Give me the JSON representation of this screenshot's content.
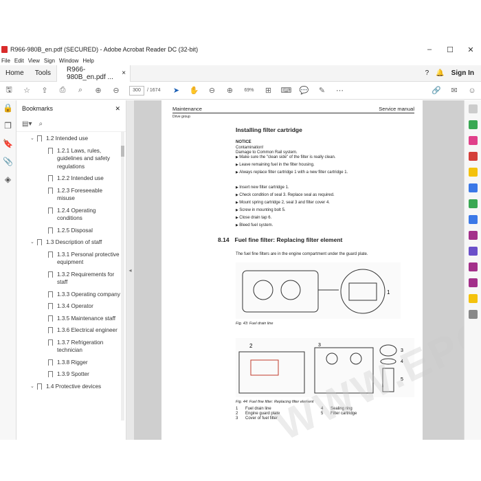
{
  "window": {
    "title": "R966-980B_en.pdf (SECURED) - Adobe Acrobat Reader DC (32-bit)",
    "minimize": "–",
    "maximize": "☐",
    "close": "✕"
  },
  "menu": [
    "File",
    "Edit",
    "View",
    "Sign",
    "Window",
    "Help"
  ],
  "tabs": {
    "home": "Home",
    "tools": "Tools",
    "doc": "R966-980B_en.pdf ...",
    "doc_close": "×",
    "signin": "Sign In"
  },
  "toolbar": {
    "page_current": "300",
    "page_total": "/ 1674",
    "zoom": "69%"
  },
  "bookmarks": {
    "title": "Bookmarks",
    "close": "✕",
    "items": [
      {
        "label": "1.2 Intended use",
        "level": 1
      },
      {
        "label": "1.2.1 Laws, rules, guidelines and safety regulations",
        "level": 2
      },
      {
        "label": "1.2.2 Intended use",
        "level": 2
      },
      {
        "label": "1.2.3 Foreseeable misuse",
        "level": 2
      },
      {
        "label": "1.2.4 Operating conditions",
        "level": 2
      },
      {
        "label": "1.2.5 Disposal",
        "level": 2
      },
      {
        "label": "1.3 Description of staff",
        "level": 1
      },
      {
        "label": "1.3.1 Personal protective equipment",
        "level": 2
      },
      {
        "label": "1.3.2 Requirements for staff",
        "level": 2
      },
      {
        "label": "1.3.3 Operating company",
        "level": 2
      },
      {
        "label": "1.3.4 Operator",
        "level": 2
      },
      {
        "label": "1.3.5 Maintenance staff",
        "level": 2
      },
      {
        "label": "1.3.6 Electrical engineer",
        "level": 2
      },
      {
        "label": "1.3.7 Refrigeration technician",
        "level": 2
      },
      {
        "label": "1.3.8 Rigger",
        "level": 2
      },
      {
        "label": "1.3.9 Spotter",
        "level": 2
      },
      {
        "label": "1.4 Protective devices",
        "level": 1
      }
    ]
  },
  "doc": {
    "header_left": "Maintenance",
    "header_right": "Service manual",
    "subheader": "Drive group",
    "install_title": "Installing filter cartridge",
    "notice_title": "NOTICE",
    "notice_lines": [
      "Contamination!",
      "Damage to Common Rail system."
    ],
    "notice_bullets": [
      "Make sure the \"clean side\" of the filter is really clean.",
      "Leave remaining fuel in the filter housing.",
      "Always replace filter cartridge 1 with a new filter cartridge 1."
    ],
    "steps": [
      "Insert new filter cartridge 1.",
      "Check condition of seal 3. Replace seal as required.",
      "Mount spring cartridge 2, seal 3 and filter cover 4.",
      "Screw in mounting bolt 5.",
      "Close drain tap 6.",
      "Bleed fuel system."
    ],
    "section_number": "8.14",
    "section_title": "Fuel fine filter: Replacing filter element",
    "section_para": "The fuel fine filters are in the engine compartment under the guard plate.",
    "fig43_caption": "Fig. 43: Fuel drain line",
    "fig44_caption": "Fig. 44: Fuel fine filter: Replacing filter element",
    "legend": [
      [
        "1",
        "Fuel drain line",
        "4",
        "Sealing ring"
      ],
      [
        "2",
        "Engine guard plate",
        "5",
        "Filter cartridge"
      ],
      [
        "3",
        "Cover of fuel filter",
        "",
        ""
      ]
    ]
  },
  "watermark": "WWW.EPC-PRO.COM"
}
